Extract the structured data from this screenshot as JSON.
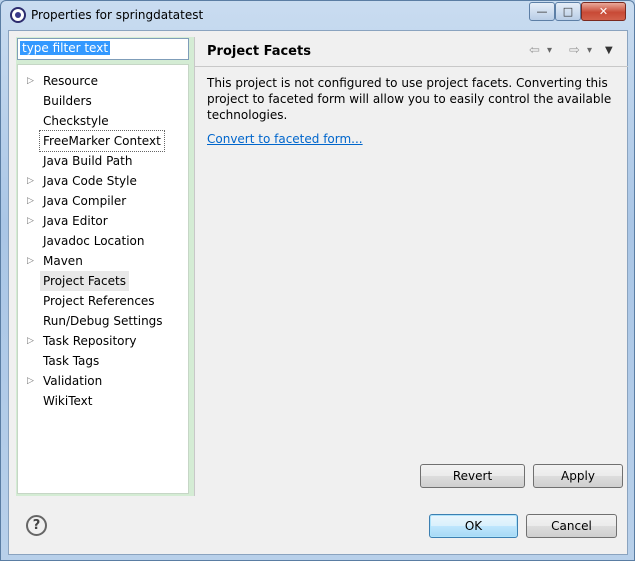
{
  "window": {
    "title": "Properties for springdatatest",
    "min_glyph": "▭",
    "max_glyph": "▭",
    "close_glyph": "✕"
  },
  "filter": {
    "placeholder": "type filter text"
  },
  "tree": {
    "items": [
      {
        "label": "Resource",
        "expandable": true
      },
      {
        "label": "Builders",
        "expandable": false
      },
      {
        "label": "Checkstyle",
        "expandable": false
      },
      {
        "label": "FreeMarker Context",
        "expandable": false,
        "focused": true
      },
      {
        "label": "Java Build Path",
        "expandable": false
      },
      {
        "label": "Java Code Style",
        "expandable": true
      },
      {
        "label": "Java Compiler",
        "expandable": true
      },
      {
        "label": "Java Editor",
        "expandable": true
      },
      {
        "label": "Javadoc Location",
        "expandable": false
      },
      {
        "label": "Maven",
        "expandable": true
      },
      {
        "label": "Project Facets",
        "expandable": false,
        "selected": true
      },
      {
        "label": "Project References",
        "expandable": false
      },
      {
        "label": "Run/Debug Settings",
        "expandable": false
      },
      {
        "label": "Task Repository",
        "expandable": true
      },
      {
        "label": "Task Tags",
        "expandable": false
      },
      {
        "label": "Validation",
        "expandable": true
      },
      {
        "label": "WikiText",
        "expandable": false
      }
    ]
  },
  "page": {
    "title": "Project Facets",
    "description": "This project is not configured to use project facets. Converting this project to faceted form will allow you to easily control the available technologies.",
    "link": "Convert to faceted form..."
  },
  "buttons": {
    "revert": "Revert",
    "apply": "Apply",
    "ok": "OK",
    "cancel": "Cancel",
    "help": "?"
  },
  "icons": {
    "back": "⇦",
    "forward": "⇨",
    "dropdown": "▾",
    "menu": "▼",
    "expand": "▷"
  }
}
